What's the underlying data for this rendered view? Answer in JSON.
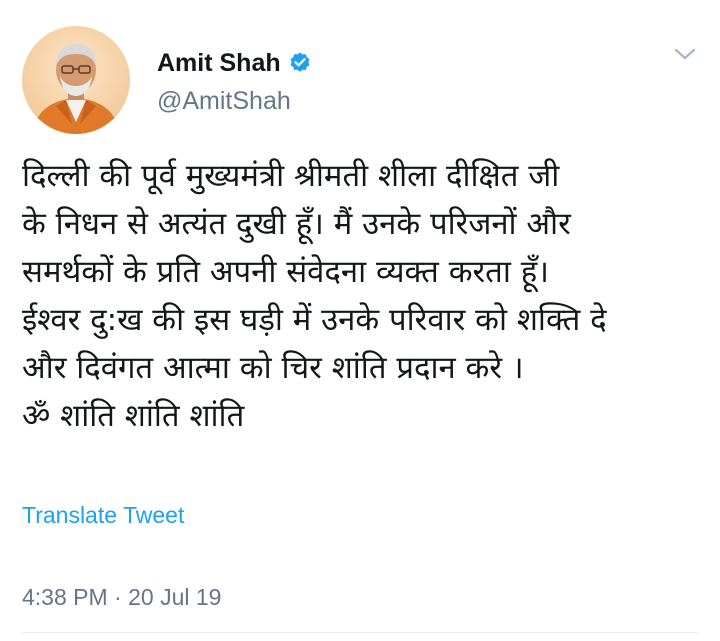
{
  "user": {
    "display_name": "Amit Shah",
    "handle": "@AmitShah",
    "verified": true,
    "avatar_icon": "profile-photo"
  },
  "menu": {
    "icon": "chevron-down-icon"
  },
  "tweet": {
    "lines": [
      "दिल्ली की पूर्व मुख्यमंत्री श्रीमती शीला दीक्षित जी",
      "के निधन से अत्यंत दुखी हूँ। मैं उनके परिजनों और",
      "समर्थकों के प्रति अपनी संवेदना व्यक्त करता हूँ।",
      "ईश्वर दु:ख की इस घड़ी में उनके परिवार को शक्ति दे",
      "और दिवंगत आत्मा को चिर शांति प्रदान करे ।",
      "ॐ शांति शांति शांति"
    ],
    "translate_label": "Translate Tweet",
    "timestamp": "4:38 PM · 20 Jul 19"
  },
  "colors": {
    "link": "#1da1f2",
    "secondary_text": "#657786",
    "primary_text": "#14171a",
    "verified_badge": "#1da1f2"
  }
}
